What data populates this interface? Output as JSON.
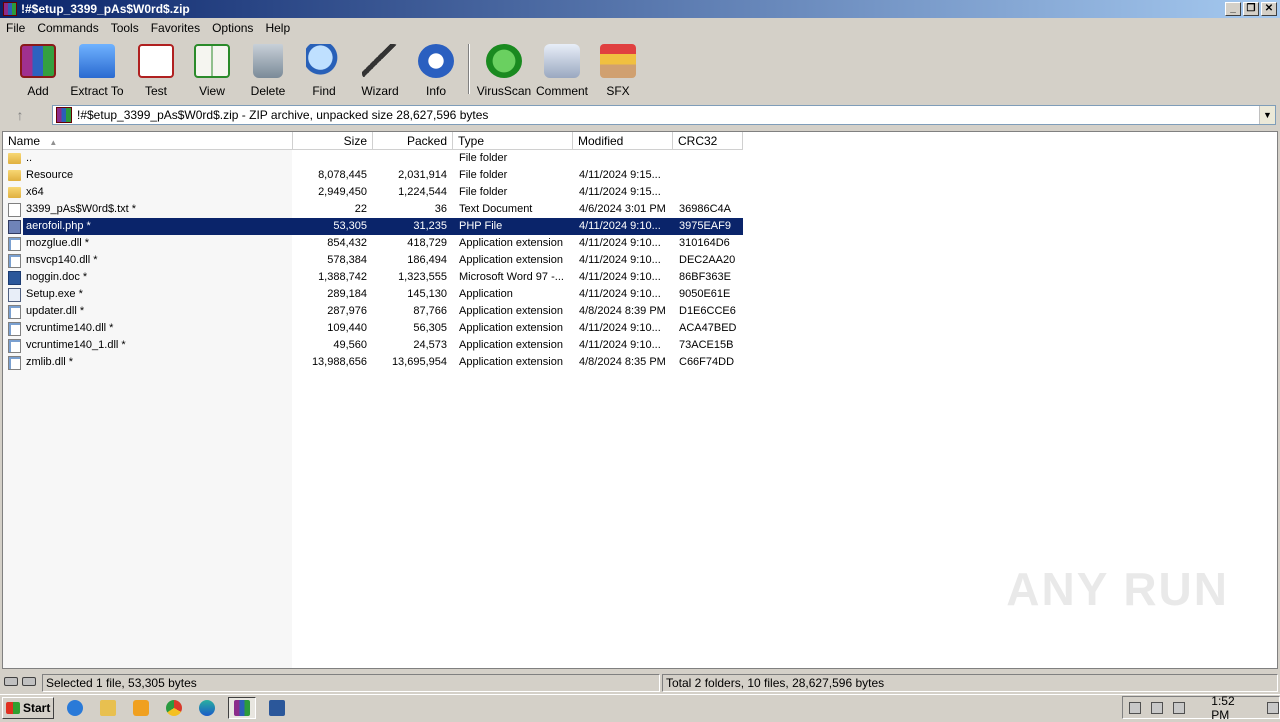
{
  "window": {
    "title": "!#$etup_3399_pAs$W0rd$.zip"
  },
  "menu": [
    "File",
    "Commands",
    "Tools",
    "Favorites",
    "Options",
    "Help"
  ],
  "toolbar": {
    "add": "Add",
    "extract": "Extract To",
    "test": "Test",
    "view": "View",
    "delete": "Delete",
    "find": "Find",
    "wizard": "Wizard",
    "info": "Info",
    "virusscan": "VirusScan",
    "comment": "Comment",
    "sfx": "SFX"
  },
  "address": {
    "text": "!#$etup_3399_pAs$W0rd$.zip - ZIP archive, unpacked size 28,627,596 bytes"
  },
  "columns": {
    "name": "Name",
    "size": "Size",
    "packed": "Packed",
    "type": "Type",
    "modified": "Modified",
    "crc": "CRC32"
  },
  "files": [
    {
      "name": "..",
      "size": "",
      "packed": "",
      "type": "File folder",
      "modified": "",
      "crc": "",
      "icon": "folder"
    },
    {
      "name": "Resource",
      "size": "8,078,445",
      "packed": "2,031,914",
      "type": "File folder",
      "modified": "4/11/2024 9:15...",
      "crc": "",
      "icon": "folder"
    },
    {
      "name": "x64",
      "size": "2,949,450",
      "packed": "1,224,544",
      "type": "File folder",
      "modified": "4/11/2024 9:15...",
      "crc": "",
      "icon": "folder"
    },
    {
      "name": "3399_pAs$W0rd$.txt *",
      "size": "22",
      "packed": "36",
      "type": "Text Document",
      "modified": "4/6/2024 3:01 PM",
      "crc": "36986C4A",
      "icon": "doc"
    },
    {
      "name": "aerofoil.php *",
      "size": "53,305",
      "packed": "31,235",
      "type": "PHP File",
      "modified": "4/11/2024 9:10...",
      "crc": "3975EAF9",
      "icon": "php",
      "selected": true
    },
    {
      "name": "mozglue.dll *",
      "size": "854,432",
      "packed": "418,729",
      "type": "Application extension",
      "modified": "4/11/2024 9:10...",
      "crc": "310164D6",
      "icon": "dll"
    },
    {
      "name": "msvcp140.dll *",
      "size": "578,384",
      "packed": "186,494",
      "type": "Application extension",
      "modified": "4/11/2024 9:10...",
      "crc": "DEC2AA20",
      "icon": "dll"
    },
    {
      "name": "noggin.doc *",
      "size": "1,388,742",
      "packed": "1,323,555",
      "type": "Microsoft Word 97 -...",
      "modified": "4/11/2024 9:10...",
      "crc": "86BF363E",
      "icon": "word"
    },
    {
      "name": "Setup.exe *",
      "size": "289,184",
      "packed": "145,130",
      "type": "Application",
      "modified": "4/11/2024 9:10...",
      "crc": "9050E61E",
      "icon": "exe"
    },
    {
      "name": "updater.dll *",
      "size": "287,976",
      "packed": "87,766",
      "type": "Application extension",
      "modified": "4/8/2024 8:39 PM",
      "crc": "D1E6CCE6",
      "icon": "dll"
    },
    {
      "name": "vcruntime140.dll *",
      "size": "109,440",
      "packed": "56,305",
      "type": "Application extension",
      "modified": "4/11/2024 9:10...",
      "crc": "ACA47BED",
      "icon": "dll"
    },
    {
      "name": "vcruntime140_1.dll *",
      "size": "49,560",
      "packed": "24,573",
      "type": "Application extension",
      "modified": "4/11/2024 9:10...",
      "crc": "73ACE15B",
      "icon": "dll"
    },
    {
      "name": "zmlib.dll *",
      "size": "13,988,656",
      "packed": "13,695,954",
      "type": "Application extension",
      "modified": "4/8/2024 8:35 PM",
      "crc": "C66F74DD",
      "icon": "dll"
    }
  ],
  "status": {
    "left": "Selected 1 file, 53,305 bytes",
    "right": "Total 2 folders, 10 files, 28,627,596 bytes"
  },
  "taskbar": {
    "start": "Start",
    "clock": "1:52 PM"
  },
  "watermark": "ANY RUN"
}
